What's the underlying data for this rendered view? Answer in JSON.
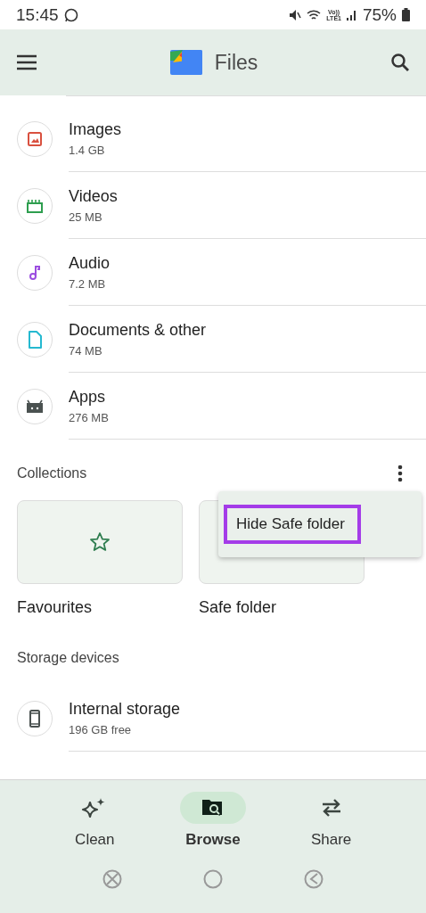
{
  "status_bar": {
    "time": "15:45",
    "network": "Vo))\nLTE1",
    "battery": "75%"
  },
  "app_bar": {
    "title": "Files"
  },
  "categories": [
    {
      "kind": "image",
      "name": "Images",
      "size": "1.4 GB",
      "color": "#d9503f"
    },
    {
      "kind": "video",
      "name": "Videos",
      "size": "25 MB",
      "color": "#2e9e4f"
    },
    {
      "kind": "audio",
      "name": "Audio",
      "size": "7.2 MB",
      "color": "#9b4de0"
    },
    {
      "kind": "document",
      "name": "Documents & other",
      "size": "74 MB",
      "color": "#25b9d0"
    },
    {
      "kind": "apps",
      "name": "Apps",
      "size": "276 MB",
      "color": "#4a5150"
    }
  ],
  "collections": {
    "title": "Collections",
    "items": [
      {
        "kind": "favourites",
        "label": "Favourites"
      },
      {
        "kind": "safe",
        "label": "Safe folder"
      }
    ],
    "menu": [
      {
        "label": "Hide Safe folder",
        "highlighted": true
      }
    ]
  },
  "storage": {
    "title": "Storage devices",
    "items": [
      {
        "kind": "phone",
        "name": "Internal storage",
        "size": "196 GB free"
      }
    ]
  },
  "bottom_nav": [
    {
      "kind": "clean",
      "label": "Clean",
      "selected": false
    },
    {
      "kind": "browse",
      "label": "Browse",
      "selected": true
    },
    {
      "kind": "share",
      "label": "Share",
      "selected": false
    }
  ]
}
